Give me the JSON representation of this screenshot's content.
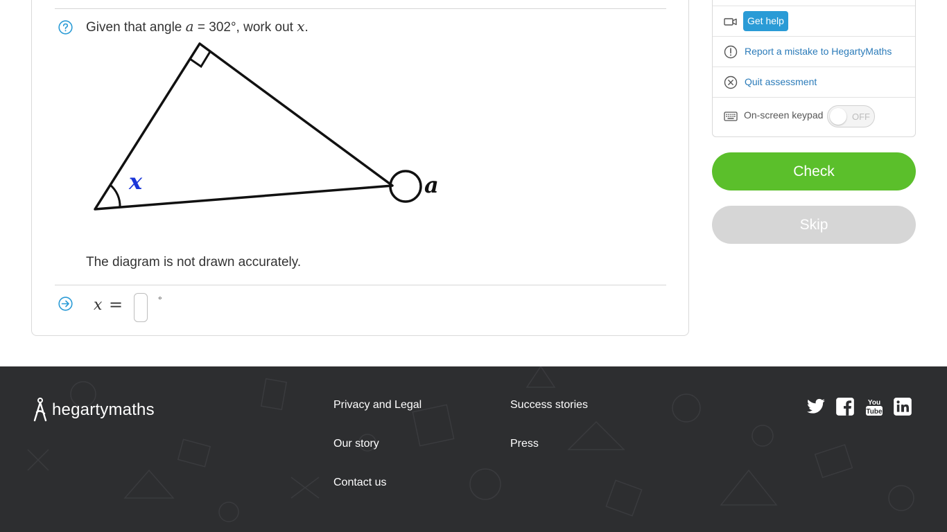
{
  "question": {
    "text_prefix": "Given that angle ",
    "var_a": "a",
    "text_middle": " = 302°, work out ",
    "var_x": "x",
    "text_suffix": ".",
    "diagram_labels": {
      "angle_x": "x",
      "angle_a": "a"
    },
    "note": "The diagram is not drawn accurately."
  },
  "answer": {
    "var": "x",
    "equals": "=",
    "value": "",
    "unit": "°"
  },
  "panel": {
    "get_help": "Get help",
    "report": "Report a mistake to HegartyMaths",
    "quit": "Quit assessment",
    "keypad_label": "On-screen keypad",
    "keypad_state": "OFF"
  },
  "buttons": {
    "check": "Check",
    "skip": "Skip"
  },
  "footer": {
    "logo": "hegartymaths",
    "links_col1": [
      "Privacy and Legal",
      "Our story",
      "Contact us"
    ],
    "links_col2": [
      "Success stories",
      "Press"
    ],
    "social": [
      "twitter-icon",
      "facebook-icon",
      "youtube-icon",
      "linkedin-icon"
    ]
  },
  "colors": {
    "accent_blue": "#2b7bb9",
    "check_green": "#5bbf2b",
    "skip_grey": "#d6d6d6",
    "footer_bg": "#2d2e30",
    "angle_label_blue": "#1a35d8"
  }
}
